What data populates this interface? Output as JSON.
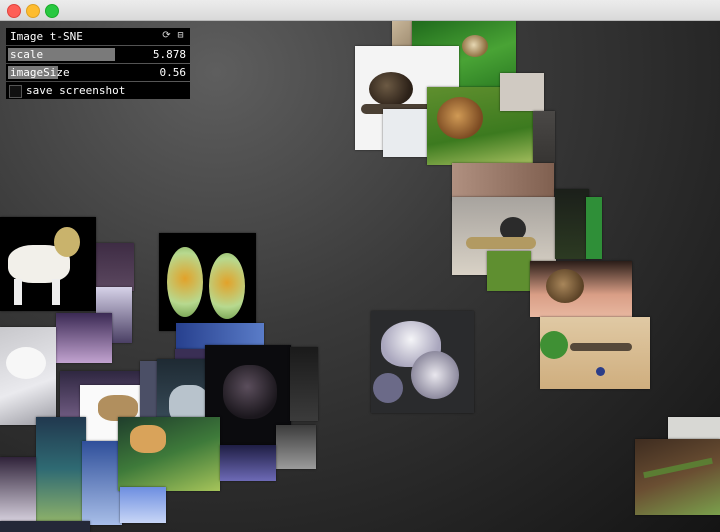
{
  "window": {
    "buttons": [
      "close-button",
      "minimize-button",
      "maximize-button"
    ]
  },
  "panel": {
    "title": "Image t-SNE",
    "icons": [
      "refresh-icon",
      "minimize-panel-icon"
    ],
    "sliders": [
      {
        "label": "scale",
        "value": "5.878",
        "fill": 0.62
      },
      {
        "label": "imageSize",
        "value": "0.56",
        "fill": 0.28
      }
    ],
    "toggle": {
      "label": "save screenshot",
      "checked": false
    }
  },
  "thumbnails": {
    "subjects": [
      "snail",
      "unicorn",
      "corn",
      "iris-flower",
      "plant"
    ]
  }
}
